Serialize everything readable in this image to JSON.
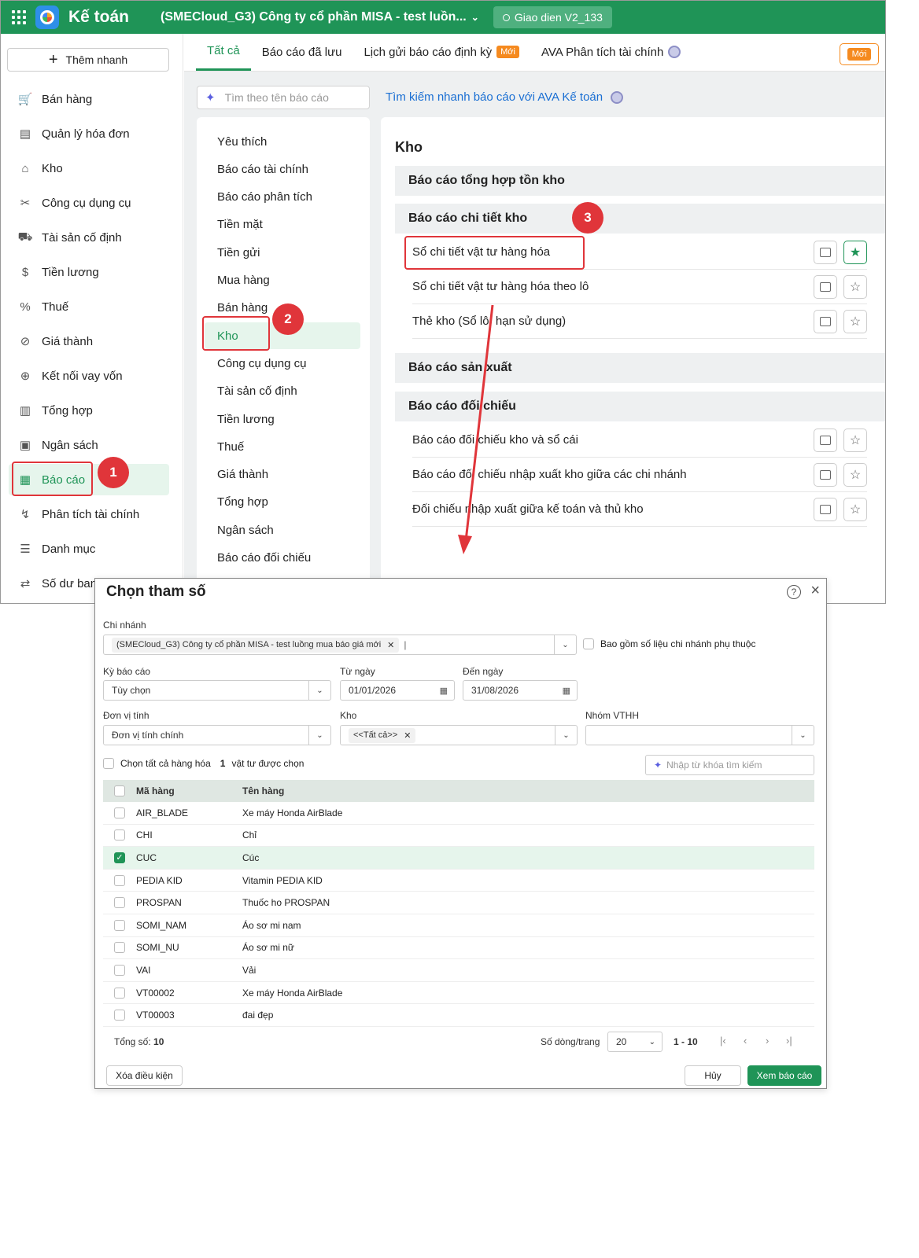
{
  "topbar": {
    "app_title": "Kế toán",
    "company": "(SMECloud_G3) Công ty cổ phần MISA - test luồn...",
    "ui_version": "Giao dien V2_133"
  },
  "sidebar": {
    "quick_add": "Thêm nhanh",
    "items": [
      {
        "label": "Bán hàng",
        "icon": "cart-icon"
      },
      {
        "label": "Quản lý hóa đơn",
        "icon": "invoice-icon"
      },
      {
        "label": "Kho",
        "icon": "warehouse-icon"
      },
      {
        "label": "Công cụ dụng cụ",
        "icon": "tools-icon"
      },
      {
        "label": "Tài sản cố định",
        "icon": "car-icon"
      },
      {
        "label": "Tiền lương",
        "icon": "dollar-icon"
      },
      {
        "label": "Thuế",
        "icon": "tax-icon"
      },
      {
        "label": "Giá thành",
        "icon": "tag-icon"
      },
      {
        "label": "Kết nối vay vốn",
        "icon": "link-icon"
      },
      {
        "label": "Tổng hợp",
        "icon": "book-icon"
      },
      {
        "label": "Ngân sách",
        "icon": "budget-icon"
      },
      {
        "label": "Báo cáo",
        "icon": "chart-icon"
      },
      {
        "label": "Phân tích tài chính",
        "icon": "analysis-icon"
      },
      {
        "label": "Danh mục",
        "icon": "list-icon"
      },
      {
        "label": "Số dư ban",
        "icon": "balance-icon"
      }
    ]
  },
  "tabs": {
    "all": "Tất cả",
    "saved": "Báo cáo đã lưu",
    "schedule": "Lịch gửi báo cáo định kỳ",
    "new_badge": "Mới",
    "ava": "AVA Phân tích tài chính",
    "new_button": "Mới"
  },
  "search": {
    "placeholder": "Tìm theo tên báo cáo",
    "ava_link": "Tìm kiếm nhanh báo cáo với AVA Kế toán"
  },
  "categories": [
    "Yêu thích",
    "Báo cáo tài chính",
    "Báo cáo phân tích",
    "Tiền mặt",
    "Tiền gửi",
    "Mua hàng",
    "Bán hàng",
    "Kho",
    "Công cụ dụng cụ",
    "Tài sản cố định",
    "Tiền lương",
    "Thuế",
    "Giá thành",
    "Tổng hợp",
    "Ngân sách",
    "Báo cáo đối chiếu"
  ],
  "content": {
    "title": "Kho",
    "groups": [
      {
        "title": "Báo cáo tổng hợp tồn kho",
        "reports": []
      },
      {
        "title": "Báo cáo chi tiết kho",
        "reports": [
          "Sổ chi tiết vật tư hàng hóa",
          "Sổ chi tiết vật tư hàng hóa theo lô",
          "Thẻ kho (Sổ lô, hạn sử dụng)"
        ]
      },
      {
        "title": "Báo cáo sản xuất",
        "reports": []
      },
      {
        "title": "Báo cáo đối chiếu",
        "reports": [
          "Báo cáo đối chiếu kho và sổ cái",
          "Báo cáo đối chiếu nhập xuất kho giữa các chi nhánh",
          "Đối chiếu nhập xuất giữa kế toán và thủ kho"
        ]
      }
    ]
  },
  "annotations": [
    "1",
    "2",
    "3"
  ],
  "dialog": {
    "title": "Chọn tham số",
    "branch_label": "Chi nhánh",
    "branch_value": "(SMECloud_G3) Công ty cổ phần MISA - test luồng mua báo giá mới",
    "include_sub": "Bao gồm số liệu chi nhánh phụ thuộc",
    "period_label": "Kỳ báo cáo",
    "period_value": "Tùy chọn",
    "from_label": "Từ ngày",
    "from_value": "01/01/2026",
    "to_label": "Đến ngày",
    "to_value": "31/08/2026",
    "unit_label": "Đơn vị tính",
    "unit_value": "Đơn vị tính chính",
    "warehouse_label": "Kho",
    "warehouse_value": "<<Tất cả>>",
    "group_label": "Nhóm VTHH",
    "group_value": "",
    "select_all": "Chọn tất cả hàng hóa",
    "selected_count": "1",
    "selected_suffix": "vật tư được chọn",
    "search_placeholder": "Nhập từ khóa tìm kiếm",
    "col_code": "Mã hàng",
    "col_name": "Tên hàng",
    "rows": [
      {
        "code": "AIR_BLADE",
        "name": "Xe máy Honda AirBlade",
        "checked": false
      },
      {
        "code": "CHI",
        "name": "Chỉ",
        "checked": false
      },
      {
        "code": "CUC",
        "name": "Cúc",
        "checked": true
      },
      {
        "code": "PEDIA KID",
        "name": "Vitamin PEDIA KID",
        "checked": false
      },
      {
        "code": "PROSPAN",
        "name": "Thuốc ho PROSPAN",
        "checked": false
      },
      {
        "code": "SOMI_NAM",
        "name": "Áo sơ mi nam",
        "checked": false
      },
      {
        "code": "SOMI_NU",
        "name": "Áo sơ mi nữ",
        "checked": false
      },
      {
        "code": "VAI",
        "name": "Vải",
        "checked": false
      },
      {
        "code": "VT00002",
        "name": "Xe máy Honda AirBlade",
        "checked": false
      },
      {
        "code": "VT00003",
        "name": "đai đẹp",
        "checked": false
      }
    ],
    "total_label": "Tổng số:",
    "total_value": "10",
    "rows_per_page_label": "Số dòng/trang",
    "rows_per_page": "20",
    "range": "1 - 10",
    "clear": "Xóa điều kiện",
    "cancel": "Hủy",
    "view": "Xem báo cáo"
  },
  "colors": {
    "brand": "#1f9457",
    "accent": "#f58a1f",
    "annotation": "#e0353a",
    "link": "#1a6fd3"
  }
}
